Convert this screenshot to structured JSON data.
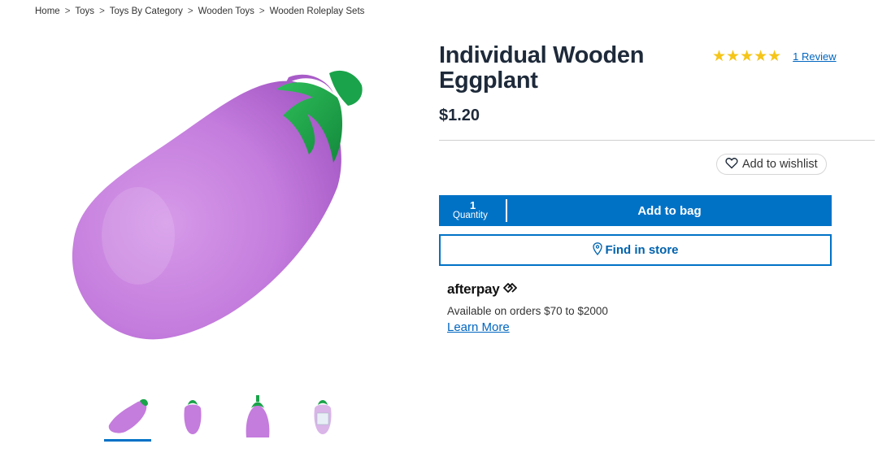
{
  "breadcrumb": {
    "items": [
      "Home",
      "Toys",
      "Toys By Category",
      "Wooden Toys",
      "Wooden Roleplay Sets"
    ],
    "separator": ">"
  },
  "product": {
    "title": "Individual Wooden Eggplant",
    "price": "$1.20",
    "stars": "★★★★★",
    "rating_value": 5,
    "review_link": "1 Review"
  },
  "wishlist": {
    "label": "Add to wishlist",
    "icon": "heart-icon"
  },
  "purchase": {
    "quantity_value": "1",
    "quantity_label": "Quantity",
    "add_to_bag": "Add to bag",
    "find_in_store": "Find in store",
    "store_icon": "map-pin-icon"
  },
  "afterpay": {
    "logo": "afterpay",
    "text": "Available on orders $70 to $2000",
    "link": "Learn More"
  },
  "gallery": {
    "thumbnail_count": 4,
    "active_index": 0
  },
  "colors": {
    "accent": "#0072c6",
    "star": "#f5c518",
    "eggplant": "#c77ee0",
    "stem": "#1aa34a"
  }
}
